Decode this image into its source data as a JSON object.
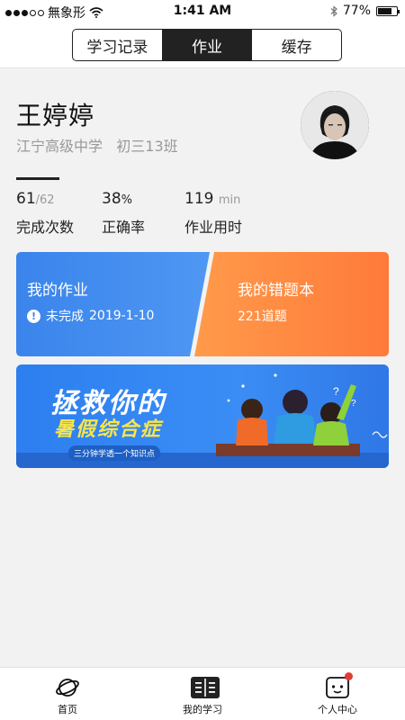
{
  "status_bar": {
    "carrier": "無象形",
    "time": "1:41 AM",
    "battery": "77%",
    "battery_level": 0.77
  },
  "segmented": {
    "tabs": [
      "学习记录",
      "作业",
      "缓存"
    ],
    "active_index": 1
  },
  "profile": {
    "name": "王婷婷",
    "school": "江宁高级中学",
    "class": "初三13班"
  },
  "stats": {
    "completed": "61",
    "completed_total": "/62",
    "completed_label": "完成次数",
    "accuracy": "38",
    "accuracy_unit": "%",
    "accuracy_label": "正确率",
    "time": "119",
    "time_unit": "min",
    "time_label": "作业用时"
  },
  "homework_card": {
    "title": "我的作业",
    "status": "未完成",
    "date": "2019-1-10",
    "color": "#3a84ec"
  },
  "wrong_card": {
    "title": "我的错题本",
    "count": "221道题",
    "color": "#ff7a3d"
  },
  "banner": {
    "title_line1": "拯救你的",
    "title_line2": "暑假综合症",
    "subtitle": "三分钟学透一个知识点"
  },
  "tabbar": {
    "items": [
      {
        "label": "首页",
        "icon": "planet-icon"
      },
      {
        "label": "我的学习",
        "icon": "book-icon"
      },
      {
        "label": "个人中心",
        "icon": "robot-face-icon"
      }
    ]
  }
}
